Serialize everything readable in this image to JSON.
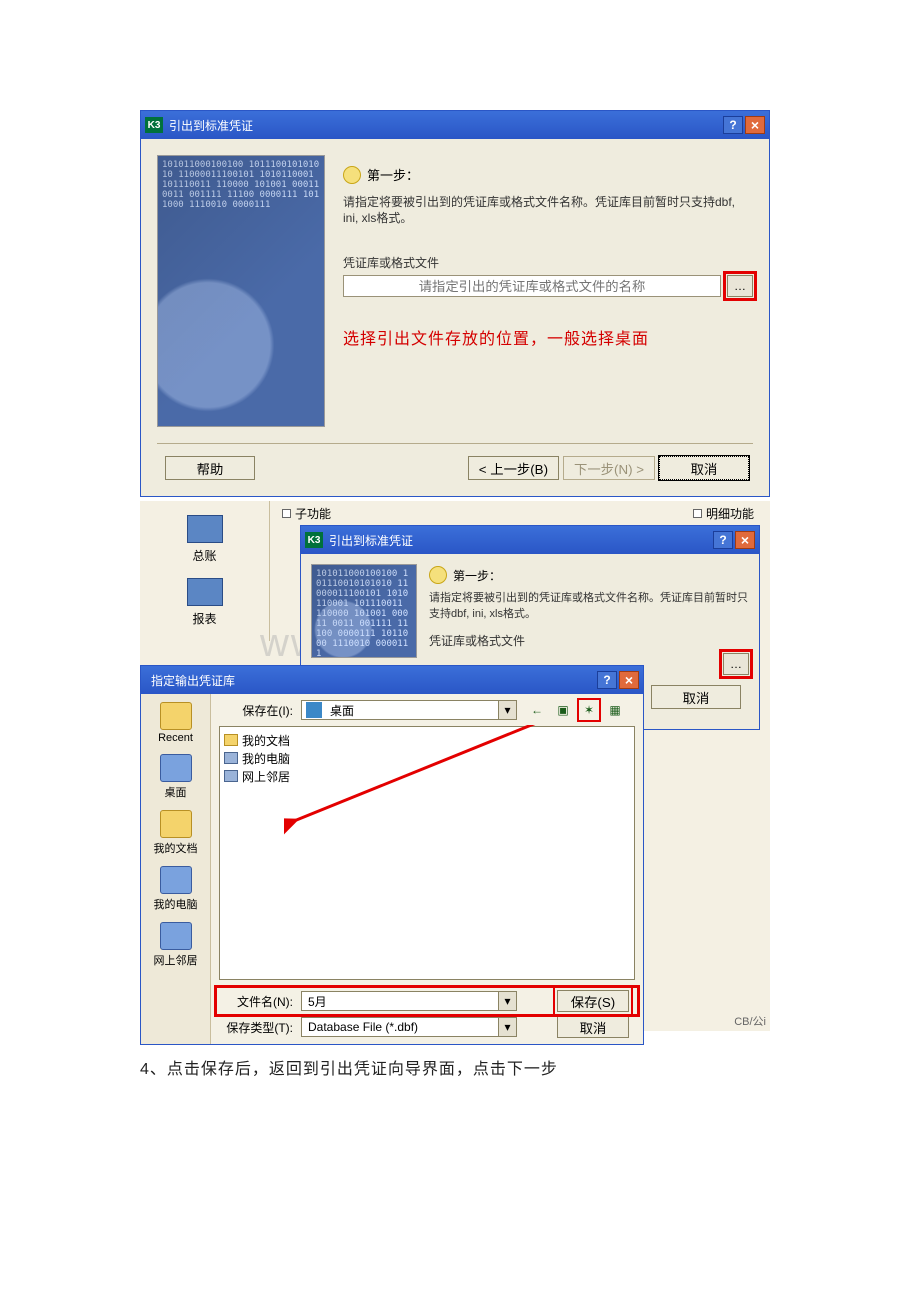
{
  "dialog1": {
    "title": "引出到标准凭证",
    "k3": "K3",
    "binary": "101011000100100\n101110010101010\n11000011100101\n1010110001\n101110011\n110000\n101001\n00011\n0011\n001111\n11100\n0000111\n1011000\n1110010\n0000111",
    "step_label": "第一步：",
    "step_desc": "请指定将要被引出到的凭证库或格式文件名称。凭证库目前暂时只支持dbf, ini, xls格式。",
    "field_label": "凭证库或格式文件",
    "field_placeholder": "请指定引出的凭证库或格式文件的名称",
    "red_note": "选择引出文件存放的位置，一般选择桌面",
    "help_btn": "帮助",
    "prev_btn": "< 上一步(B)",
    "next_btn": "下一步(N) >",
    "cancel_btn": "取消"
  },
  "panel2": {
    "sidebar": [
      {
        "label": "总账"
      },
      {
        "label": "报表"
      }
    ],
    "tab_left": "子功能",
    "tab_right": "明细功能",
    "watermark": "www.bdocx.com",
    "cap": "CB/公i"
  },
  "dialog2": {
    "title": "引出到标准凭证",
    "step_label": "第一步：",
    "step_desc": "请指定将要被引出到的凭证库或格式文件名称。凭证库目前暂时只支持dbf, ini, xls格式。",
    "field_label": "凭证库或格式文件",
    "cancel_btn": "取消",
    "arrow_prev": ">"
  },
  "savedlg": {
    "title": "指定输出凭证库",
    "save_in_label": "保存在(I):",
    "save_in_value": "桌面",
    "side": [
      {
        "label": "Recent"
      },
      {
        "label": "桌面"
      },
      {
        "label": "我的文档"
      },
      {
        "label": "我的电脑"
      },
      {
        "label": "网上邻居"
      }
    ],
    "list": [
      {
        "label": "我的文档",
        "kind": "folder"
      },
      {
        "label": "我的电脑",
        "kind": "pc"
      },
      {
        "label": "网上邻居",
        "kind": "pc"
      }
    ],
    "toolbar": {
      "back": "←",
      "up": "▣",
      "new": "✶",
      "view": "▦"
    },
    "filename_label": "文件名(N):",
    "filename_value": "5月",
    "filetype_label": "保存类型(T):",
    "filetype_value": "Database File (*.dbf)",
    "save_btn": "保存(S)",
    "cancel_btn": "取消"
  },
  "instruction": "4、点击保存后，返回到引出凭证向导界面，点击下一步"
}
